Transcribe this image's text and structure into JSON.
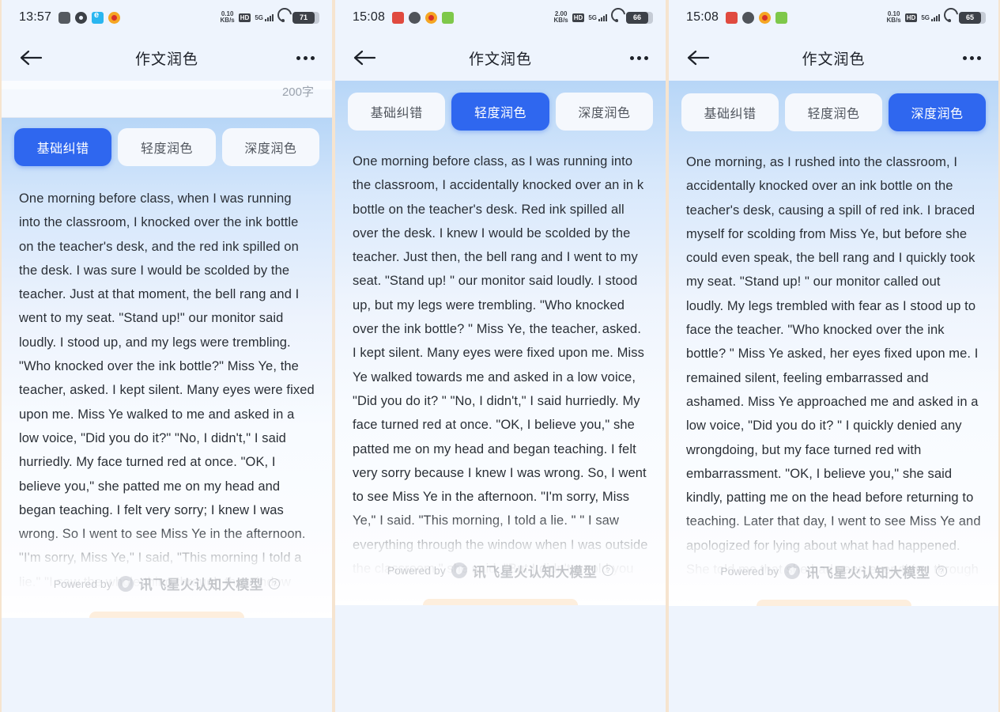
{
  "panels": [
    {
      "statusbar": {
        "time": "13:57",
        "left_icons": [
          "square-icon",
          "gear-icon",
          "browser-icon",
          "alarm-icon"
        ],
        "net_speed": "0.10",
        "net_speed_unit": "KB/s",
        "hd_label": "HD",
        "network_label": "5G",
        "signal_icon": "signal-bars-icon",
        "wifi_icon": "wifi-icon",
        "battery": "71"
      },
      "navbar": {
        "back_icon": "back-arrow-icon",
        "title": "作文润色",
        "more_icon": "more-dots-icon"
      },
      "pre_text": "200字",
      "tabs": [
        {
          "label": "基础纠错",
          "active": true
        },
        {
          "label": "轻度润色",
          "active": false
        },
        {
          "label": "深度润色",
          "active": false
        }
      ],
      "essay": "One morning before class, when I was running into the classroom, I knocked over the ink bottle on the teacher's desk, and the red ink spilled on the desk. I was sure I would be scolded by the teacher. Just at that moment, the bell rang and I went to my seat. \"Stand up!\" our monitor said loudly. I stood up, and my legs were trembling. \"Who knocked over the ink bottle?\" Miss Ye, the teacher, asked. I kept silent. Many eyes were fixed upon me. Miss Ye walked to me and asked in a low voice, \"Did you do it?\" \"No, I didn't,\" I said hurriedly. My face turned red at once. \"OK, I believe you,\" she patted me on my head and began teaching. I felt very sorry; I knew I was wrong. So I went to see Miss Ye in the afternoon. \"I'm sorry, Miss Ye,\" I said, \"This morning I told a lie.\" \"I saw the whole thing through the window when I was outside the classroom,\" she said.",
      "footer": {
        "powered_label": "Powered by",
        "brand": "讯飞星火认知大模型",
        "help_icon": "question-mark-icon",
        "flame_icon": "spark-flame-icon"
      }
    },
    {
      "statusbar": {
        "time": "15:08",
        "left_icons": [
          "red-app-icon",
          "chat-bubble-icon",
          "orange-app-icon",
          "green-app-icon"
        ],
        "net_speed": "2.00",
        "net_speed_unit": "KB/s",
        "hd_label": "HD",
        "network_label": "5G",
        "signal_icon": "signal-bars-icon",
        "wifi_icon": "wifi-icon",
        "battery": "66"
      },
      "navbar": {
        "back_icon": "back-arrow-icon",
        "title": "作文润色",
        "more_icon": "more-dots-icon"
      },
      "pre_text": "",
      "tabs": [
        {
          "label": "基础纠错",
          "active": false
        },
        {
          "label": "轻度润色",
          "active": true
        },
        {
          "label": "深度润色",
          "active": false
        }
      ],
      "essay": "One morning before class, as I was running into the classroom, I accidentally knocked over an in k bottle on the teacher's desk. Red ink spilled all over the desk. I knew I would be scolded by the teacher. Just then, the bell rang and I went to my seat. \"Stand up! \" our monitor said loudly. I stood up, but my legs were trembling. \"Who knocked over the ink bottle? \" Miss Ye, the teacher, asked. I kept silent. Many eyes were fixed upon me. Miss Ye walked towards me and asked in a low voice, \"Did you do it? \" \"No, I didn't,\" I said hurriedly. My face turned red at once. \"OK, I believe you,\" she patted me on my head and began teaching. I felt very sorry because I knew I was wrong. So, I went to see Miss Ye in the afternoon. \"I'm sorry, Miss Ye,\" I said. \"This morning, I told a lie. \" \" I saw everything through the window when I was outside the classroom,\" she said. \"But I didn't s cold you because I knew I would",
      "footer": {
        "powered_label": "Powered by",
        "brand": "讯飞星火认知大模型",
        "help_icon": "question-mark-icon",
        "flame_icon": "spark-flame-icon"
      }
    },
    {
      "statusbar": {
        "time": "15:08",
        "left_icons": [
          "red-app-icon",
          "chat-bubble-icon",
          "orange-app-icon",
          "green-app-icon"
        ],
        "net_speed": "0.10",
        "net_speed_unit": "KB/s",
        "hd_label": "HD",
        "network_label": "5G",
        "signal_icon": "signal-bars-icon",
        "wifi_icon": "wifi-icon",
        "battery": "65"
      },
      "navbar": {
        "back_icon": "back-arrow-icon",
        "title": "作文润色",
        "more_icon": "more-dots-icon"
      },
      "pre_text": "",
      "tabs": [
        {
          "label": "基础纠错",
          "active": false
        },
        {
          "label": "轻度润色",
          "active": false
        },
        {
          "label": "深度润色",
          "active": true
        }
      ],
      "essay": "One morning, as I rushed into the classroom, I accidentally knocked over an ink bottle on the teacher's desk, causing a spill of red ink. I braced myself for scolding from Miss Ye, but before she could even speak, the bell rang and I quickly took my seat. \"Stand up! \" our monitor called out loudly. My legs trembled with fear as I stood up to face the teacher. \"Who knocked over the ink bottle? \" Miss Ye asked, her eyes fixed upon me. I remained silent, feeling embarrassed and ashamed. Miss Ye approached me and asked in a low voice, \"Did you do it? \" I quickly denied any wrongdoing, but my face turned red with embarrassment. \"OK, I believe you,\" she said kindly, patting me on the head before returning to teaching. Later that day, I went to see Miss Ye and apologized for lying about what had happened. She told me that she had seen everything through the",
      "footer": {
        "powered_label": "Powered by",
        "brand": "讯飞星火认知大模型",
        "help_icon": "question-mark-icon",
        "flame_icon": "spark-flame-icon"
      }
    }
  ],
  "colors": {
    "accent": "#2f67ef",
    "tab_inactive_bg": "#f5f8fd",
    "gradient_top": "#b7d6f7",
    "panel_divider": "#f6e4cf",
    "text": "#2a2f36"
  }
}
